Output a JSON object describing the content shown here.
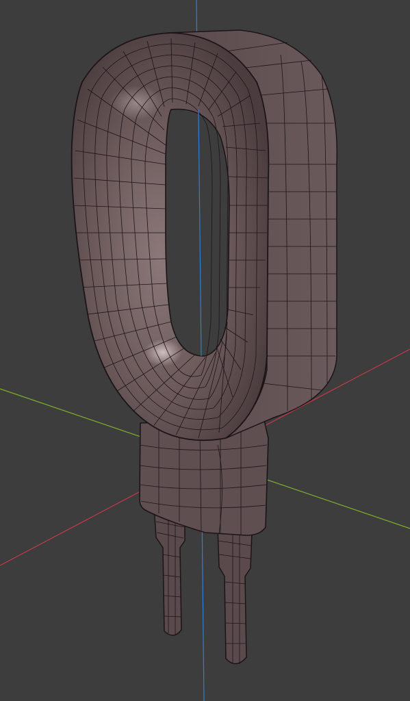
{
  "viewport": {
    "background": "#3d3d3d",
    "shading": "solid-with-wireframe-overlay"
  },
  "axes": {
    "x_axis_color": "#c9394a",
    "y_axis_color": "#7fb32a",
    "z_axis_color": "#2f7fd6"
  },
  "model": {
    "object": "ring-terminal-with-two-pins",
    "base_color": "#5e4e4f",
    "highlight_color": "#a99596",
    "wire_color": "#1c1416",
    "pin_count": 2
  }
}
